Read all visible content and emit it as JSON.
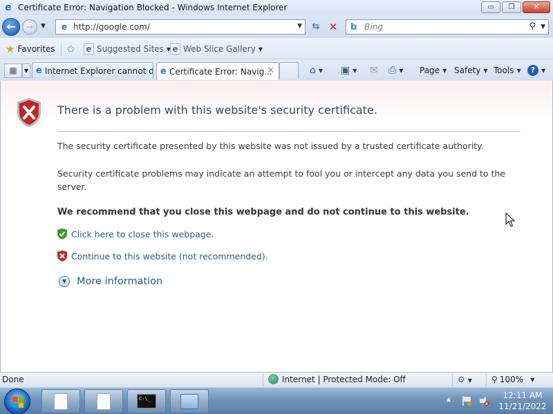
{
  "window": {
    "title": "Certificate Error: Navigation Blocked - Windows Internet Explorer",
    "minimize": "▭",
    "maximize": "❐",
    "close": "✕"
  },
  "address_bar": {
    "url": "http://google.com/",
    "search_placeholder": "Bing"
  },
  "favorites_bar": {
    "favorites_label": "Favorites",
    "suggested_sites_label": "Suggested Sites",
    "web_slice_gallery_label": "Web Slice Gallery"
  },
  "tabs": [
    {
      "label": "Internet Explorer cannot di..."
    },
    {
      "label": "Certificate Error: Navig..."
    }
  ],
  "command_bar": {
    "page_label": "Page",
    "safety_label": "Safety",
    "tools_label": "Tools"
  },
  "page": {
    "heading": "There is a problem with this website's security certificate.",
    "para1": "The security certificate presented by this website was not issued by a trusted certificate authority.",
    "para2": "Security certificate problems may indicate an attempt to fool you or intercept any data you send to the server.",
    "recommend": "We recommend that you close this webpage and do not continue to this website.",
    "close_link": "Click here to close this webpage.",
    "continue_link": "Continue to this website (not recommended).",
    "more_info": "More information"
  },
  "status_bar": {
    "status": "Done",
    "zone": "Internet | Protected Mode: Off",
    "zoom": "100%"
  },
  "taskbar": {
    "time": "12:11 AM",
    "date": "11/21/2022",
    "cmd_label": "C:\\_"
  },
  "colors": {
    "link": "#1e5d8c",
    "heading": "#2f4d6b",
    "shield_red": "#c0262a",
    "shield_green": "#3a9a2e"
  }
}
